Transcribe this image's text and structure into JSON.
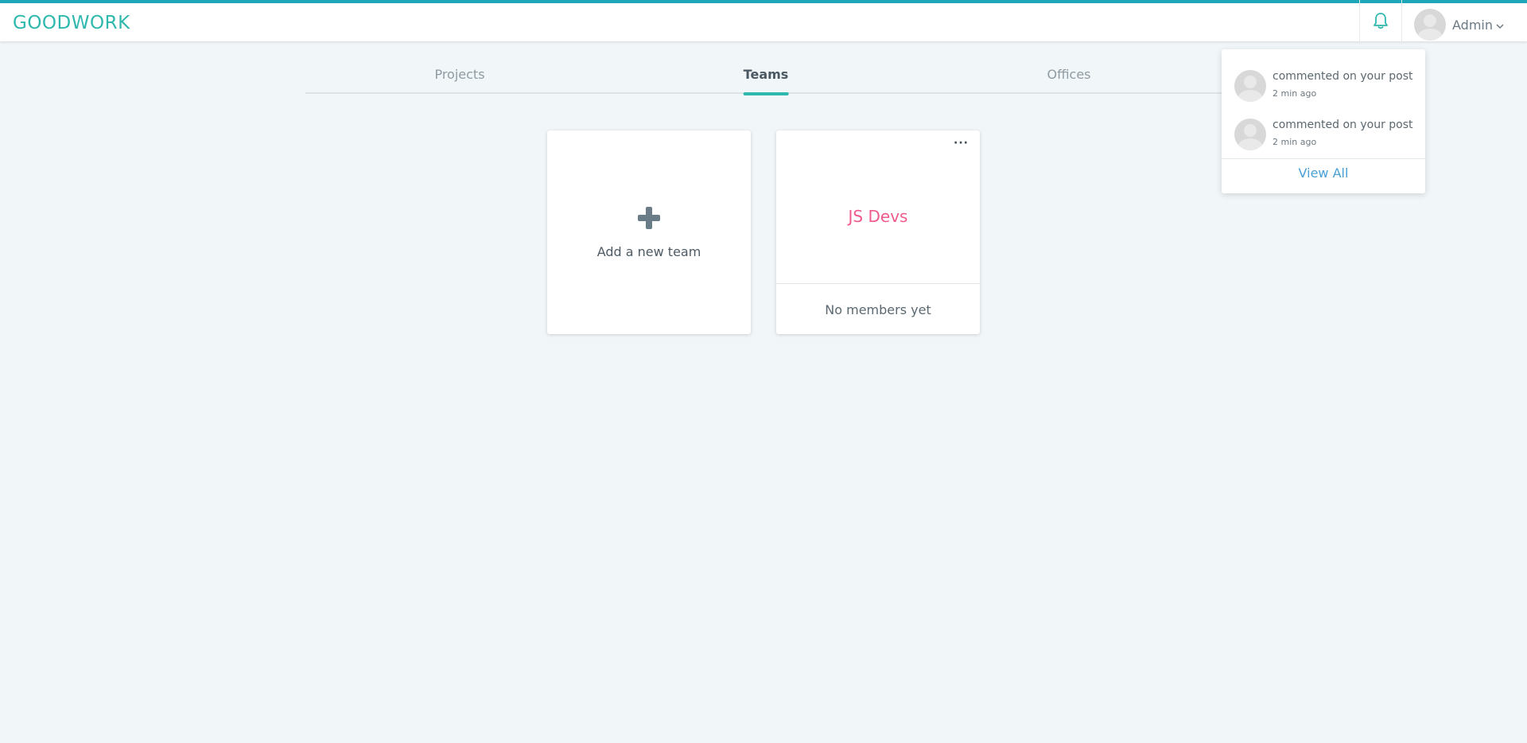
{
  "header": {
    "logo": "GOODWORK",
    "user_name": "Admin",
    "icons": {
      "notifications": "bell-icon",
      "user_menu": "chevron-down-icon"
    }
  },
  "tabs": [
    {
      "label": "Projects",
      "active": false
    },
    {
      "label": "Teams",
      "active": true
    },
    {
      "label": "Offices",
      "active": false
    }
  ],
  "cards": {
    "add": {
      "label": "Add a new team",
      "icon": "plus-icon"
    },
    "team": {
      "name": "JS Devs",
      "members": "No members yet",
      "menu": "···"
    }
  },
  "notifications": {
    "items": [
      {
        "text": "commented on your post",
        "time": "2 min ago"
      },
      {
        "text": "commented on your post",
        "time": "2 min ago"
      }
    ],
    "view_all": "View All"
  },
  "colors": {
    "accent": "#2fb8ad",
    "top_border": "#1ea7b9",
    "team_name": "#ef5a8b",
    "link": "#4a9fd5",
    "background": "#f1f6f8"
  }
}
